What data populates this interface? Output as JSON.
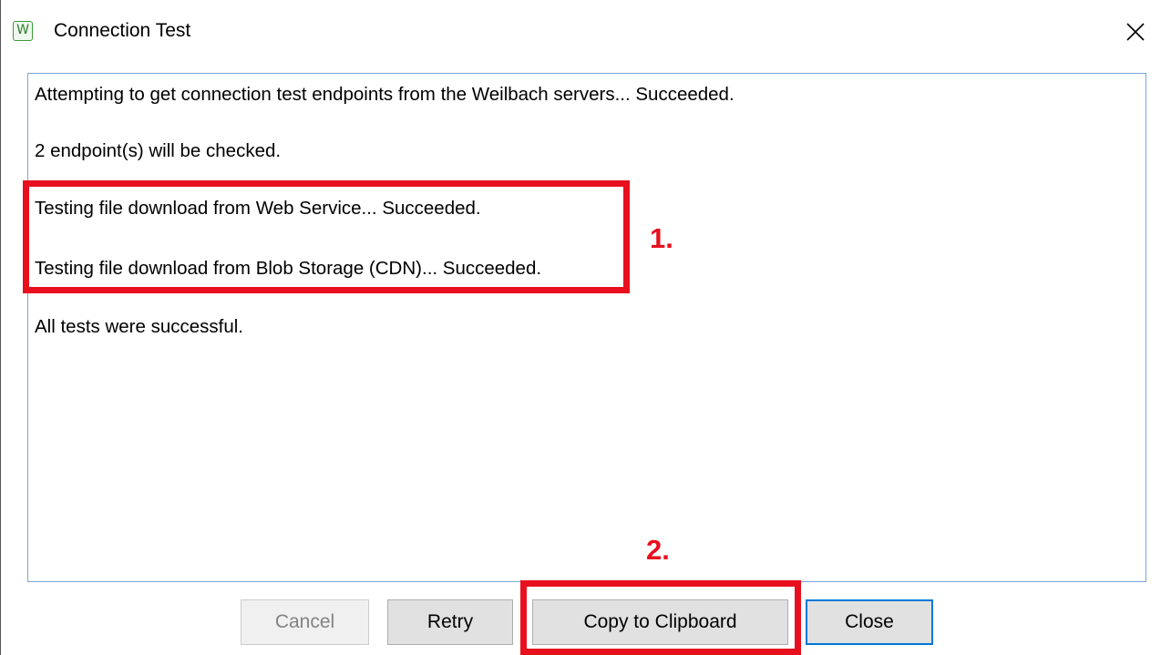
{
  "window": {
    "title": "Connection Test",
    "app_icon_letter": "W",
    "close_icon": "close-icon"
  },
  "log": {
    "lines": [
      "Attempting to get connection test endpoints from the Weilbach servers... Succeeded.",
      "2 endpoint(s) will be checked.",
      "Testing file download from Web Service... Succeeded.",
      "Testing file download from Blob Storage (CDN)... Succeeded.",
      "All tests were successful."
    ]
  },
  "annotations": {
    "first": "1.",
    "second": "2.",
    "color": "#e8101e"
  },
  "buttons": {
    "cancel": "Cancel",
    "retry": "Retry",
    "copy": "Copy to Clipboard",
    "close": "Close"
  },
  "colors": {
    "accent": "#0078d7",
    "log_border": "#7aa7d8",
    "highlight": "#e8101e"
  }
}
